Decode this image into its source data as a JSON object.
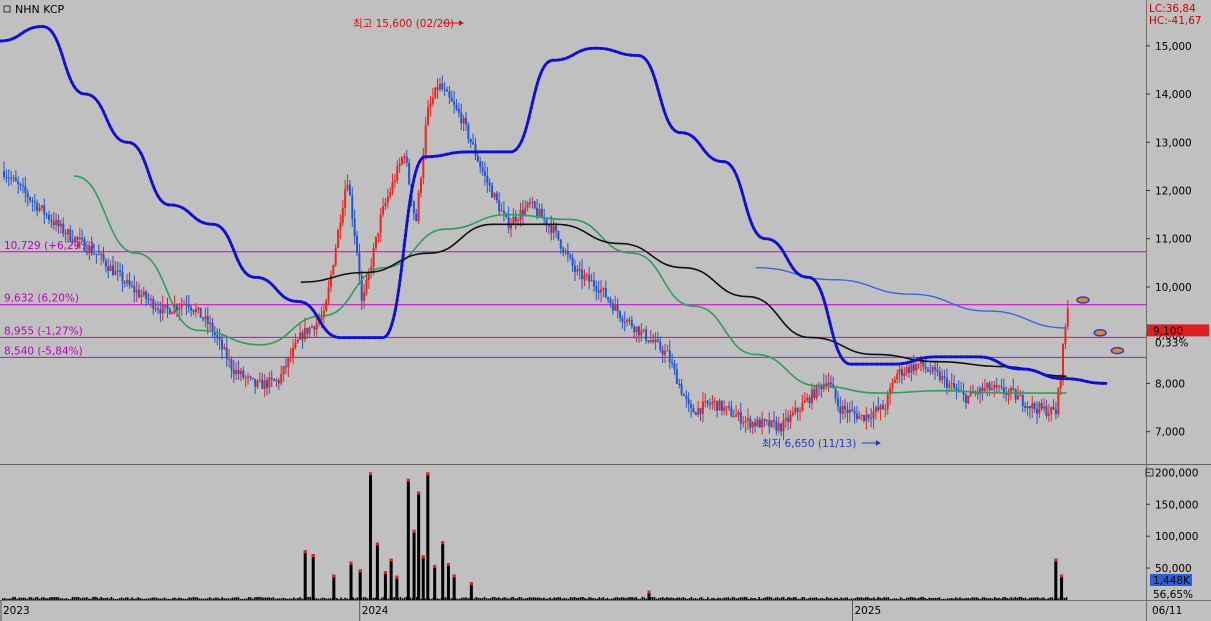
{
  "app": {
    "title": "NHN KCP",
    "lc_label": "LC:36,84",
    "hc_label": "HC:-41,67"
  },
  "colors": {
    "background": "#c0c0c0",
    "candle_up": "#e8261e",
    "candle_down": "#2255d0",
    "ma_green": "#2f9d5a",
    "ma_black": "#111111",
    "ma_blue_thin": "#3a66e0",
    "envelope_blue": "#1010d0",
    "level_line": "#d000d0",
    "volume": "#000000"
  },
  "chart_data": [
    {
      "type": "candlestick",
      "name": "price",
      "y_ticks": [
        "15,000",
        "14,000",
        "13,000",
        "12,000",
        "11,000",
        "10,000",
        "9,000",
        "8,000",
        "7,000"
      ],
      "y_tick_values": [
        15000,
        14000,
        13000,
        12000,
        11000,
        10000,
        9000,
        8000,
        7000
      ],
      "ylim": [
        6350,
        15950
      ],
      "x_ticks": [
        "2023",
        "2024",
        "2025",
        "06/11"
      ],
      "x_tick_positions": [
        0.0,
        0.313,
        0.743,
        1.0
      ],
      "price_path": [
        [
          0,
          12400
        ],
        [
          0.02,
          11900
        ],
        [
          0.05,
          11200
        ],
        [
          0.08,
          10700
        ],
        [
          0.11,
          10000
        ],
        [
          0.14,
          9500
        ],
        [
          0.16,
          9700
        ],
        [
          0.18,
          9200
        ],
        [
          0.2,
          8300
        ],
        [
          0.22,
          7950
        ],
        [
          0.24,
          8050
        ],
        [
          0.26,
          9000
        ],
        [
          0.28,
          9400
        ],
        [
          0.3,
          12300
        ],
        [
          0.31,
          10500
        ],
        [
          0.313,
          9600
        ],
        [
          0.33,
          11500
        ],
        [
          0.35,
          12800
        ],
        [
          0.36,
          11300
        ],
        [
          0.37,
          13600
        ],
        [
          0.38,
          14200
        ],
        [
          0.4,
          13500
        ],
        [
          0.42,
          12300
        ],
        [
          0.44,
          11300
        ],
        [
          0.46,
          11700
        ],
        [
          0.48,
          11200
        ],
        [
          0.5,
          10300
        ],
        [
          0.52,
          10000
        ],
        [
          0.54,
          9400
        ],
        [
          0.56,
          9000
        ],
        [
          0.58,
          8600
        ],
        [
          0.6,
          7400
        ],
        [
          0.62,
          7600
        ],
        [
          0.65,
          7200
        ],
        [
          0.68,
          7100
        ],
        [
          0.7,
          7600
        ],
        [
          0.72,
          8100
        ],
        [
          0.73,
          7500
        ],
        [
          0.75,
          7300
        ],
        [
          0.77,
          7500
        ],
        [
          0.78,
          8200
        ],
        [
          0.8,
          8400
        ],
        [
          0.82,
          8100
        ],
        [
          0.84,
          7700
        ],
        [
          0.86,
          7900
        ],
        [
          0.88,
          7800
        ],
        [
          0.9,
          7500
        ],
        [
          0.92,
          7400
        ],
        [
          0.927,
          9000
        ],
        [
          0.93,
          9600
        ]
      ],
      "price_range": [
        0.0,
        0.93
      ],
      "series": [
        {
          "name": "MA green",
          "color": "#2f9d5a",
          "start": 0.065,
          "points": [
            12300,
            10700,
            9100,
            8800,
            9400,
            10400,
            11200,
            11500,
            11400,
            10700,
            9600,
            8600,
            7950,
            7800,
            7850,
            7800,
            7800
          ]
        },
        {
          "name": "MA black",
          "color": "#111111",
          "start": 0.263,
          "points": [
            10100,
            10300,
            10700,
            11300,
            11300,
            10900,
            10400,
            9800,
            8950,
            8600,
            8450,
            8350,
            8150
          ]
        },
        {
          "name": "MA thin blue",
          "color": "#3a66e0",
          "start": 0.66,
          "points": [
            10400,
            10150,
            9850,
            9500,
            9150
          ]
        },
        {
          "name": "Envelope blue",
          "color": "#1010d0",
          "start": 0.0,
          "points": [
            15100,
            15400,
            14000,
            13000,
            11700,
            11300,
            10200,
            9700,
            8950,
            8950,
            12700,
            12800,
            12800,
            14700,
            14950,
            14800,
            13200,
            12600,
            11000,
            10200,
            8400,
            8400,
            8550,
            8550,
            8300,
            8100,
            8000
          ]
        }
      ],
      "levels": [
        {
          "label": "10,729 (+6,29%)",
          "value": 10729
        },
        {
          "label": "9,632 (6,20%)",
          "value": 9632
        },
        {
          "label": "8,955 (-1,27%)",
          "value": 8955
        },
        {
          "label": "8,540 (-5,84%)",
          "value": 8540
        }
      ],
      "annotations": {
        "high": {
          "text": "최고 15,600 (02/20)",
          "value": 15600,
          "x": 0.397
        },
        "low": {
          "text": "최저 6,650 (11/13)",
          "value": 6650,
          "x": 0.677
        },
        "current_price": "9,100",
        "current_value": 9100,
        "current_pct": "0,33%"
      },
      "forecast_markers": [
        {
          "x": 0.945,
          "value": 9730
        },
        {
          "x": 0.96,
          "value": 9050
        },
        {
          "x": 0.975,
          "value": 8680
        }
      ]
    },
    {
      "type": "bar",
      "name": "volume",
      "y_ticks": [
        "200,000",
        "150,000",
        "100,000",
        "50,000"
      ],
      "y_tick_values": [
        200000,
        150000,
        100000,
        50000
      ],
      "ylim": [
        0,
        210000
      ],
      "volume_badge": "1,448K",
      "volume_pct": "56,65%",
      "spikes": [
        {
          "x": 0.265,
          "value": 78000
        },
        {
          "x": 0.272,
          "value": 72000
        },
        {
          "x": 0.29,
          "value": 40000
        },
        {
          "x": 0.305,
          "value": 60000
        },
        {
          "x": 0.313,
          "value": 48000
        },
        {
          "x": 0.322,
          "value": 200000
        },
        {
          "x": 0.328,
          "value": 90000
        },
        {
          "x": 0.335,
          "value": 45000
        },
        {
          "x": 0.34,
          "value": 65000
        },
        {
          "x": 0.345,
          "value": 38000
        },
        {
          "x": 0.355,
          "value": 190000
        },
        {
          "x": 0.36,
          "value": 110000
        },
        {
          "x": 0.364,
          "value": 170000
        },
        {
          "x": 0.368,
          "value": 70000
        },
        {
          "x": 0.372,
          "value": 200000
        },
        {
          "x": 0.378,
          "value": 55000
        },
        {
          "x": 0.385,
          "value": 92000
        },
        {
          "x": 0.39,
          "value": 58000
        },
        {
          "x": 0.395,
          "value": 40000
        },
        {
          "x": 0.41,
          "value": 28000
        },
        {
          "x": 0.565,
          "value": 15000
        },
        {
          "x": 0.92,
          "value": 65000
        },
        {
          "x": 0.925,
          "value": 40000
        }
      ]
    }
  ]
}
